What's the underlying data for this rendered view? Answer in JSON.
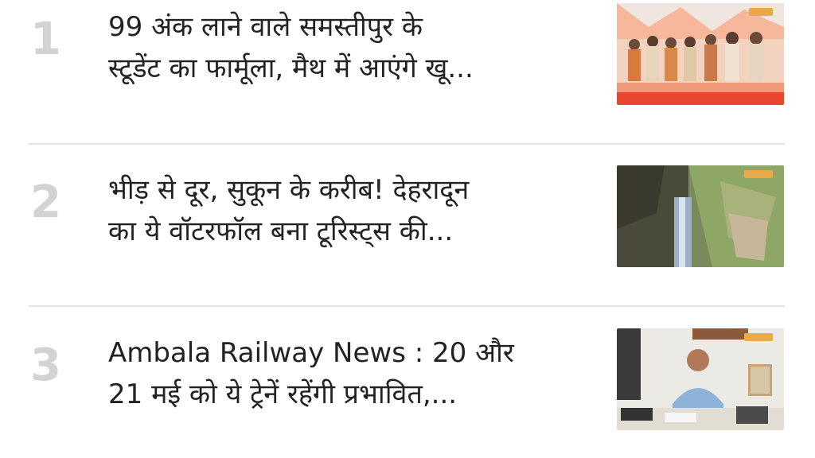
{
  "news_list": {
    "items": [
      {
        "rank": "1",
        "title_line1": "99 अंक लाने वाले समस्तीपुर के",
        "title_line2": "स्टूडेंट का फार्मूला, मैथ में आएंगे खू...",
        "thumbnail": "students-group-photo"
      },
      {
        "rank": "2",
        "title_line1": "भीड़ से दूर, सुकून के करीब! देहरादून",
        "title_line2": "का ये वॉटरफॉल बना टूरिस्ट्स की...",
        "thumbnail": "waterfall-photo"
      },
      {
        "rank": "3",
        "title_line1": "Ambala Railway News : 20 और",
        "title_line2": "21 मई को ये ट्रेनें रहेंगी प्रभावित,...",
        "thumbnail": "railway-officer-photo"
      }
    ]
  },
  "colors": {
    "rank_number": "#d3d3d3",
    "title_text": "#222222",
    "divider": "#e3e3e3",
    "badge": "#e8a948"
  }
}
